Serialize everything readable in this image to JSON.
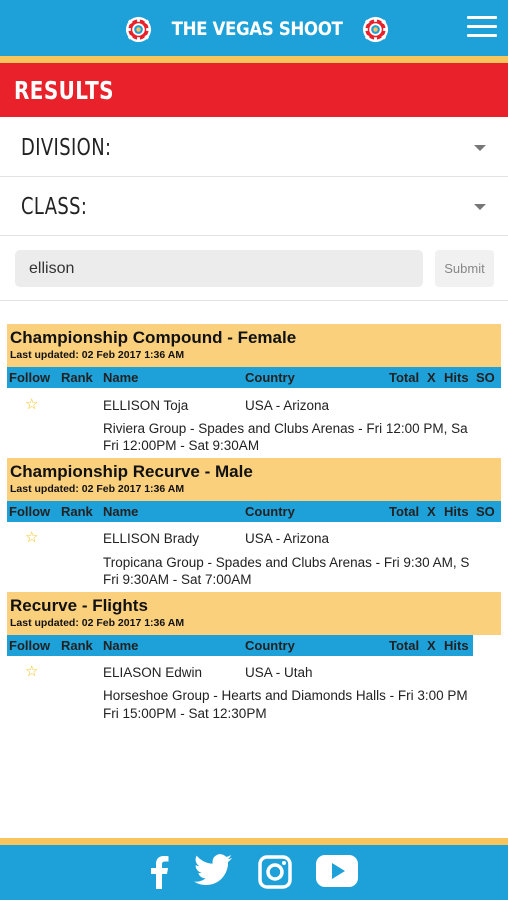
{
  "header": {
    "logo_text": "THE VEGAS SHOOT",
    "menu_icon": "hamburger-menu-icon"
  },
  "page": {
    "title": "RESULTS"
  },
  "filters": {
    "division_label": "DIVISION:",
    "class_label": "CLASS:"
  },
  "search": {
    "value": "ellison",
    "submit_label": "Submit"
  },
  "columns": {
    "follow": "Follow",
    "rank": "Rank",
    "name": "Name",
    "country": "Country",
    "total": "Total",
    "x": "X",
    "hits": "Hits",
    "so": "SO"
  },
  "sections": [
    {
      "title": "Championship Compound - Female",
      "updated": "Last updated: 02 Feb 2017 1:36 AM",
      "entries": [
        {
          "name": "ELLISON Toja",
          "country": "USA - Arizona",
          "group": "Riviera Group - Spades and Clubs Arenas - Fri 12:00 PM, Sa",
          "times": "Fri 12:00PM - Sat 9:30AM"
        }
      ]
    },
    {
      "title": "Championship Recurve - Male",
      "updated": "Last updated: 02 Feb 2017 1:36 AM",
      "entries": [
        {
          "name": "ELLISON Brady",
          "country": "USA - Arizona",
          "group": "Tropicana Group - Spades and Clubs Arenas - Fri 9:30 AM, S",
          "times": "Fri 9:30AM - Sat 7:00AM"
        }
      ]
    },
    {
      "title": "Recurve - Flights",
      "updated": "Last updated: 02 Feb 2017 1:36 AM",
      "entries": [
        {
          "name": "ELIASON Edwin",
          "country": "USA - Utah",
          "group": "Horseshoe Group - Hearts and Diamonds Halls - Fri 3:00 PM",
          "times": "Fri 15:00PM - Sat 12:30PM"
        }
      ]
    }
  ],
  "footer": {
    "icons": [
      "facebook-icon",
      "twitter-icon",
      "instagram-icon",
      "youtube-icon"
    ]
  },
  "colors": {
    "brand_blue": "#1ea0d8",
    "brand_red": "#e8212a",
    "accent_yellow": "#f7c55c",
    "section_yellow": "#fbd07c",
    "star_gold": "#f2c11b"
  }
}
